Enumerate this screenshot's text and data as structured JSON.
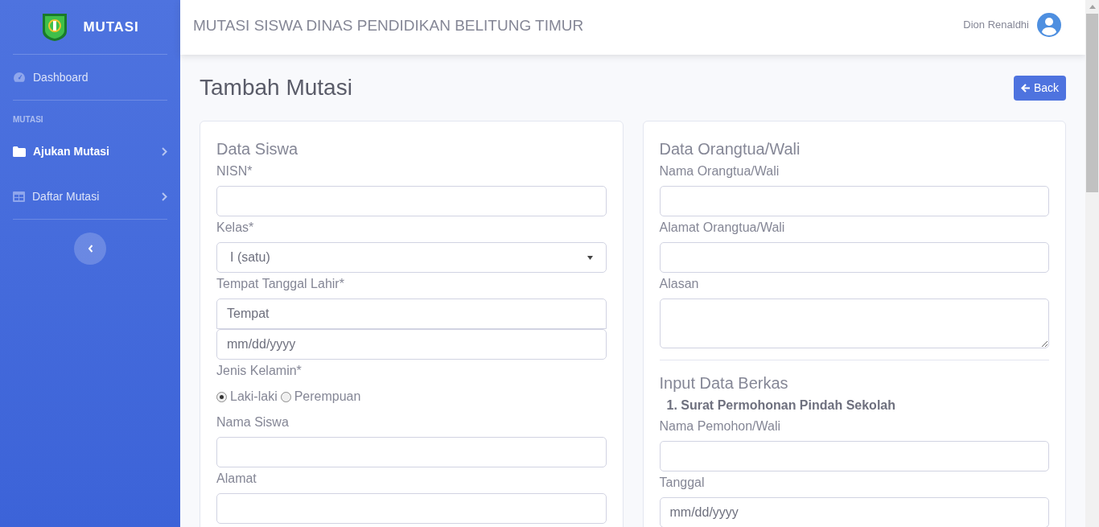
{
  "sidebar": {
    "brand": "MUTASI",
    "items": [
      {
        "kind": "link",
        "label": "Dashboard",
        "selected": false,
        "expandable": false
      },
      {
        "kind": "heading",
        "label": "MUTASI"
      },
      {
        "kind": "link",
        "label": "Ajukan Mutasi",
        "selected": true,
        "expandable": true
      },
      {
        "kind": "link",
        "label": "Daftar Mutasi",
        "selected": false,
        "expandable": true
      }
    ]
  },
  "header": {
    "title": "MUTASI SISWA DINAS PENDIDIKAN BELITUNG TIMUR",
    "user": "Dion Renaldhi"
  },
  "page": {
    "title": "Tambah Mutasi",
    "back_button": "Back"
  },
  "left_card": {
    "sections": [
      {
        "title": "Data Siswa",
        "items": [
          {
            "kind": "label",
            "text": "NISN*"
          },
          {
            "kind": "input"
          },
          {
            "kind": "label",
            "text": "Kelas*"
          },
          {
            "kind": "select",
            "value": "I (satu)"
          },
          {
            "kind": "label",
            "text": "Tempat Tanggal Lahir*"
          },
          {
            "kind": "input",
            "placeholder": "Tempat",
            "joined": true
          },
          {
            "kind": "input",
            "placeholder": "mm/dd/yyyy"
          },
          {
            "kind": "label",
            "text": "Jenis Kelamin*"
          },
          {
            "kind": "radio",
            "options": [
              {
                "label": "Laki-laki",
                "selected": true
              },
              {
                "label": "Perempuan",
                "selected": false
              }
            ]
          },
          {
            "kind": "label",
            "text": "Nama Siswa"
          },
          {
            "kind": "input"
          },
          {
            "kind": "label",
            "text": "Alamat"
          },
          {
            "kind": "input"
          }
        ]
      }
    ]
  },
  "right_card": {
    "sections": [
      {
        "title": "Data Orangtua/Wali",
        "items": [
          {
            "kind": "label",
            "text": "Nama Orangtua/Wali"
          },
          {
            "kind": "input"
          },
          {
            "kind": "label",
            "text": "Alamat Orangtua/Wali"
          },
          {
            "kind": "input"
          },
          {
            "kind": "label",
            "text": "Alasan"
          },
          {
            "kind": "textarea"
          }
        ]
      },
      {
        "title": "Input Data Berkas",
        "items": [
          {
            "kind": "subheading",
            "text": "1. Surat Permohonan Pindah Sekolah"
          },
          {
            "kind": "label",
            "text": "Nama Pemohon/Wali"
          },
          {
            "kind": "input"
          },
          {
            "kind": "label",
            "text": "Tanggal"
          },
          {
            "kind": "input",
            "placeholder": "mm/dd/yyyy"
          }
        ]
      }
    ]
  }
}
